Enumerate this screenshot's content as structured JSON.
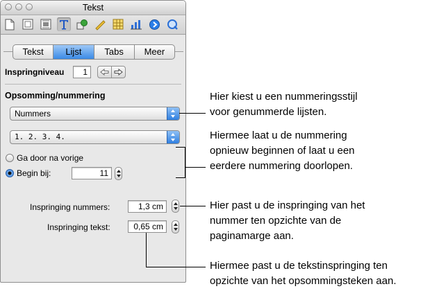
{
  "window": {
    "title": "Tekst"
  },
  "toolbar": {
    "icons": [
      "document-icon",
      "layout-icon",
      "wrap-icon",
      "text-icon",
      "graphic-icon",
      "metrics-icon",
      "table-icon",
      "chart-icon",
      "link-icon",
      "quicktime-icon"
    ]
  },
  "tabs": [
    {
      "label": "Tekst"
    },
    {
      "label": "Lijst",
      "active": true
    },
    {
      "label": "Tabs"
    },
    {
      "label": "Meer"
    }
  ],
  "indent_level": {
    "label": "Inspringniveau",
    "value": "1"
  },
  "bullets": {
    "section_label": "Opsomming/nummering",
    "style_popup": "Nummers",
    "format_popup": "1. 2. 3. 4."
  },
  "radios": {
    "continue_label": "Ga door na vorige",
    "start_label": "Begin bij:",
    "start_value": "11"
  },
  "spacing": {
    "number_indent_label": "Inspringing nummers:",
    "number_indent_value": "1,3 cm",
    "text_indent_label": "Inspringing tekst:",
    "text_indent_value": "0,65 cm"
  },
  "callouts": {
    "c1": [
      "Hier kiest u een nummeringsstijl",
      "voor genummerde lijsten."
    ],
    "c2": [
      "Hiermee laat u de nummering",
      "opnieuw beginnen of laat u een",
      "eerdere nummering doorlopen."
    ],
    "c3": [
      "Hier past u de inspringing van het",
      "nummer ten opzichte van de",
      "paginamarge aan."
    ],
    "c4": [
      "Hiermee past u de tekstinspringing ten",
      "opzichte van het opsommingsteken aan."
    ]
  },
  "colors": {
    "accent": "#3b8ae6",
    "panel": "#e8e8e8"
  }
}
